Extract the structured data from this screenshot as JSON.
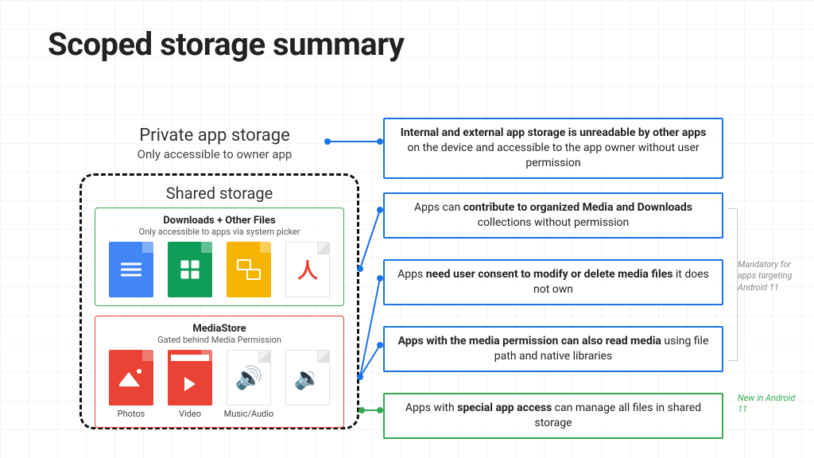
{
  "title": "Scoped storage summary",
  "private": {
    "heading": "Private app storage",
    "sub": "Only accessible to owner app"
  },
  "shared": {
    "heading": "Shared storage",
    "downloads": {
      "title": "Downloads + Other Files",
      "sub": "Only accessible to apps via system picker"
    },
    "mediastore": {
      "title": "MediaStore",
      "sub": "Gated behind Media Permission",
      "captions": [
        "Photos",
        "Video",
        "Music/Audio"
      ]
    }
  },
  "notes": [
    {
      "bold": "Internal and external app storage is unreadable by other apps",
      "rest": " on the device and accessible to the app owner without user permission"
    },
    {
      "pre": "Apps can ",
      "bold": "contribute to organized Media and Downloads",
      "rest": " collections without permission"
    },
    {
      "pre": "Apps ",
      "bold": "need user consent to modify or delete media files",
      "rest": " it does not own"
    },
    {
      "bold": "Apps with the media permission can also read media",
      "rest": " using file path and native libraries"
    },
    {
      "pre": "Apps with ",
      "bold": "special app access",
      "rest": " can manage all files in shared storage"
    }
  ],
  "side": {
    "mandatory": "Mandatory for apps targeting Android 11",
    "newin": "New in Android 11"
  }
}
